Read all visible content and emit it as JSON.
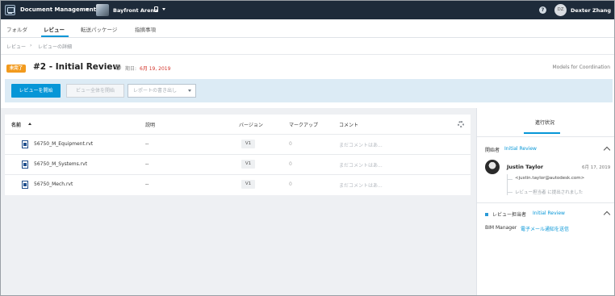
{
  "header": {
    "app_title": "Document Management",
    "project_name": "Bayfront Arena",
    "help_glyph": "?",
    "user_initials": "DZ",
    "user_name": "Dexter Zhang"
  },
  "tabs": [
    {
      "label": "フォルダ"
    },
    {
      "label": "レビュー"
    },
    {
      "label": "転送パッケージ"
    },
    {
      "label": "指摘事項"
    }
  ],
  "breadcrumb": [
    "レビュー",
    "レビューの詳細"
  ],
  "review": {
    "status": "未完了",
    "title": "#2 - Initial Review",
    "due_label": "期日:",
    "due_date": "6月 19, 2019",
    "workflow": "Models for Coordination"
  },
  "actions": {
    "start_review": "レビューを開始",
    "view_all": "ビュー全体を開始",
    "export_placeholder": "レポートの書き出し"
  },
  "table": {
    "columns": [
      "名前",
      "説明",
      "バージョン",
      "マークアップ",
      "コメント"
    ],
    "rows": [
      {
        "name": "56750_M_Equipment.rvt",
        "description": "--",
        "version": "V1",
        "markups": "0",
        "comment": "まだコメントはあ..."
      },
      {
        "name": "56750_M_Systems.rvt",
        "description": "--",
        "version": "V1",
        "markups": "0",
        "comment": "まだコメントはあ..."
      },
      {
        "name": "56750_Mech.rvt",
        "description": "--",
        "version": "V1",
        "markups": "0",
        "comment": "まだコメントはあ..."
      }
    ]
  },
  "panel": {
    "tab": "進行状況",
    "initiator_label": "開始者",
    "initiator_step": "Initial Review",
    "person_name": "Justin Taylor",
    "person_date": "6月 17, 2019",
    "person_email": "<justin.taylor@autodesk.com>",
    "person_status": "レビュー担当者 に提出されました",
    "reviewer_label": "レビュー担当者",
    "reviewer_step": "Initial Review",
    "bim_role": "BIM Manager",
    "bim_link": "電子メール通知を送信"
  }
}
